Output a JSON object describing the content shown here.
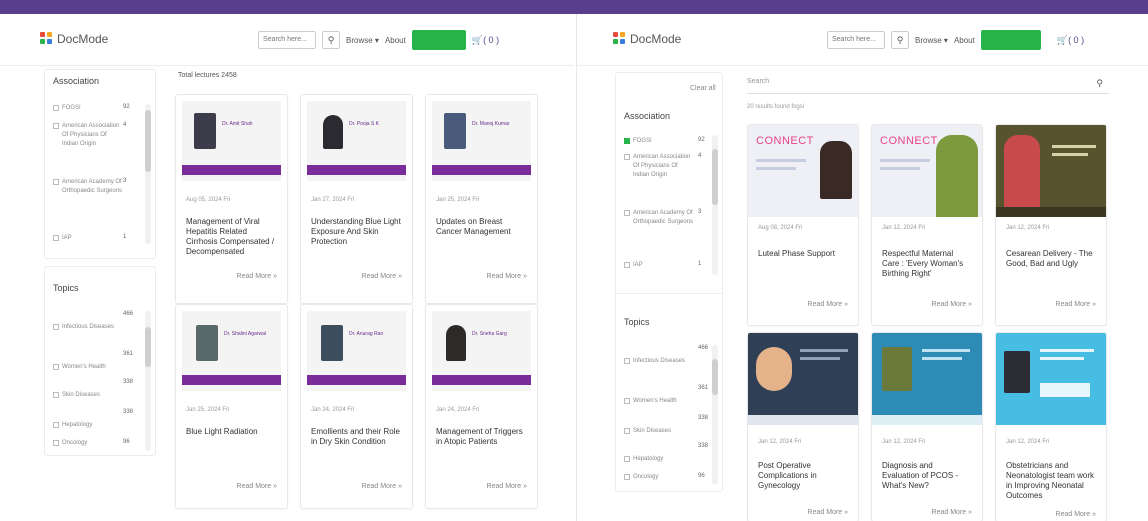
{
  "colors": {
    "purple_bar": "#5a3e8e",
    "green": "#28b34b",
    "strip": "#7a2d9a",
    "connect_pink": "#e8428a",
    "navy": "#2f3f56",
    "teal": "#2d8bb5",
    "cyan": "#48bde3",
    "olive": "#57532f"
  },
  "header": {
    "logo_text": "DocMode",
    "search_placeholder": "Search here...",
    "search_icon": "search-icon",
    "browse": "Browse",
    "browse_arrow": "▾",
    "about": "About",
    "cta_label": "",
    "cart_count": "( 0 )",
    "cart_icon": "cart-icon"
  },
  "left": {
    "total_label": "Total lectures 2458",
    "association": {
      "title": "Association",
      "items": [
        {
          "label": "FOGSI",
          "count": "92"
        },
        {
          "label": "American Association Of Physicians Of Indian Origin",
          "count": "4"
        },
        {
          "label": "American Academy Of Orthopaedic Surgeons",
          "count": "3"
        },
        {
          "label": "IAP",
          "count": "1"
        }
      ]
    },
    "topics": {
      "title": "Topics",
      "items": [
        {
          "label": "Infectious Diseases",
          "count": "466"
        },
        {
          "label": "Women's Health",
          "count": "361"
        },
        {
          "label": "Skin Diseases",
          "count": "338"
        },
        {
          "label": "Hepatology",
          "count": "338"
        },
        {
          "label": "Oncology",
          "count": "96"
        }
      ]
    },
    "cards": [
      {
        "date": "Aug 05, 2024 Fri",
        "title": "Management of Viral Hepatitis Related Cirrhosis Compensated / Decompensated",
        "read_more": "Read More »",
        "speaker": "Dr. Amit Shah"
      },
      {
        "date": "Jan 27, 2024 Fri",
        "title": "Understanding Blue Light Exposure And Skin Protection",
        "read_more": "Read More »",
        "speaker": "Dr. Pooja S K"
      },
      {
        "date": "Jan 25, 2024 Fri",
        "title": "Updates on Breast Cancer Management",
        "read_more": "Read More »",
        "speaker": "Dr. Manoj Kumar"
      },
      {
        "date": "Jan 25, 2024 Fri",
        "title": "Blue Light Radiation",
        "read_more": "Read More »",
        "speaker": "Dr. Shalini Agarwal"
      },
      {
        "date": "Jan 24, 2024 Fri",
        "title": "Emollients and their Role in Dry Skin Condition",
        "read_more": "Read More »",
        "speaker": "Dr. Anurag Rao"
      },
      {
        "date": "Jan 24, 2024 Fri",
        "title": "Management of Triggers in Atopic Patients",
        "read_more": "Read More »",
        "speaker": "Dr. Sneha Garg"
      }
    ]
  },
  "right": {
    "clear_all": "Clear all",
    "search_placeholder": "Search",
    "results_label": "20 results found fogsi",
    "association": {
      "title": "Association",
      "items": [
        {
          "label": "FOGSI",
          "count": "92",
          "checked": true
        },
        {
          "label": "American Association Of Physicians Of Indian Origin",
          "count": "4",
          "checked": false
        },
        {
          "label": "American Academy Of Orthopaedic Surgeons",
          "count": "3",
          "checked": false
        },
        {
          "label": "IAP",
          "count": "1",
          "checked": false
        }
      ]
    },
    "topics": {
      "title": "Topics",
      "items": [
        {
          "label": "Infectious Diseases",
          "count": "466"
        },
        {
          "label": "Women's Health",
          "count": "361"
        },
        {
          "label": "Skin Diseases",
          "count": "338"
        },
        {
          "label": "Hepatology",
          "count": "338"
        },
        {
          "label": "Oncology",
          "count": "96"
        }
      ]
    },
    "cards": [
      {
        "date": "Aug 08, 2024 Fri",
        "title": "Luteal Phase Support",
        "read_more": "Read More »",
        "banner_word": "CONNECT"
      },
      {
        "date": "Jan 12, 2024 Fri",
        "title": "Respectful Maternal Care : 'Every Woman's Birthing Right'",
        "read_more": "Read More »",
        "banner_word": "CONNECT"
      },
      {
        "date": "Jan 12, 2024 Fri",
        "title": "Cesarean Delivery - The Good, Bad and Ugly",
        "read_more": "Read More »",
        "banner_word": ""
      },
      {
        "date": "Jan 12, 2024 Fri",
        "title": "Post Operative Complications in Gynecology",
        "read_more": "Read More »",
        "banner_word": ""
      },
      {
        "date": "Jan 12, 2024 Fri",
        "title": "Diagnosis and Evaluation of PCOS - What's New?",
        "read_more": "Read More »",
        "banner_word": ""
      },
      {
        "date": "Jan 12, 2024 Fri",
        "title": "Obstetricians and Neonatologist team work in Improving Neonatal Outcomes",
        "read_more": "Read More »",
        "banner_word": ""
      }
    ]
  }
}
